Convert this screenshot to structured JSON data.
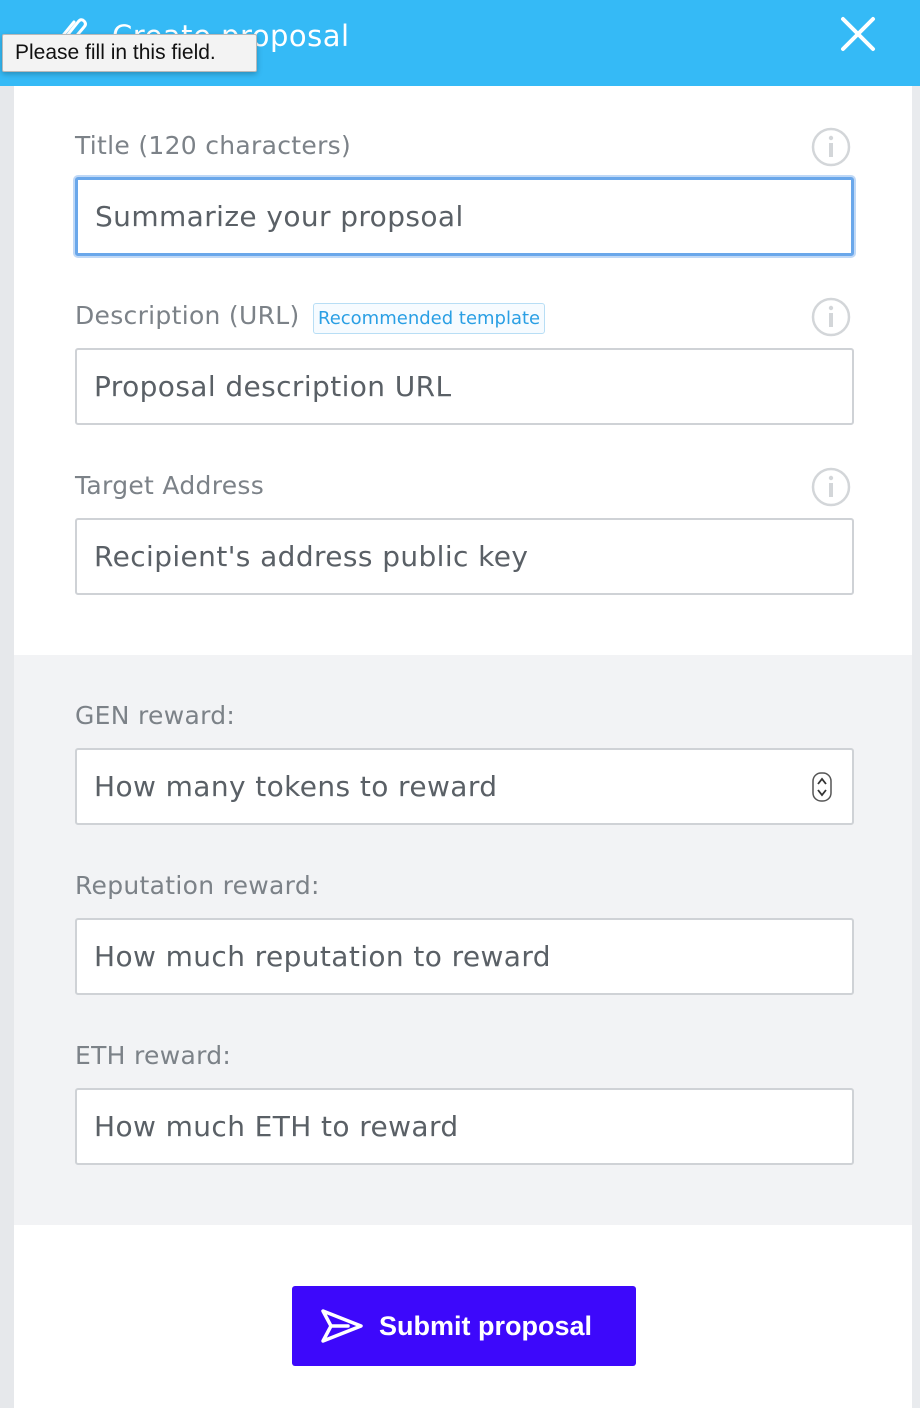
{
  "header": {
    "title": "Create proposal",
    "icon": "paperclip-icon",
    "close_icon": "close-icon",
    "background_color": "#35baf6"
  },
  "tooltip": {
    "text": "Please fill in this field."
  },
  "form": {
    "title_field": {
      "label": "Title (120 characters)",
      "placeholder": "Summarize your propsoal",
      "value": ""
    },
    "description_field": {
      "label": "Description (URL)",
      "badge": "Recommended template",
      "placeholder": "Proposal description URL",
      "value": ""
    },
    "target_field": {
      "label": "Target Address",
      "placeholder": "Recipient's address public key",
      "value": ""
    },
    "gen_reward_field": {
      "label": "GEN reward:",
      "placeholder": "How many tokens to reward",
      "value": ""
    },
    "reputation_reward_field": {
      "label": "Reputation reward:",
      "placeholder": "How much reputation to reward",
      "value": ""
    },
    "eth_reward_field": {
      "label": "ETH reward:",
      "placeholder": "How much ETH to reward",
      "value": ""
    }
  },
  "submit": {
    "label": "Submit proposal",
    "icon": "send-icon",
    "color": "#3d08fb"
  }
}
